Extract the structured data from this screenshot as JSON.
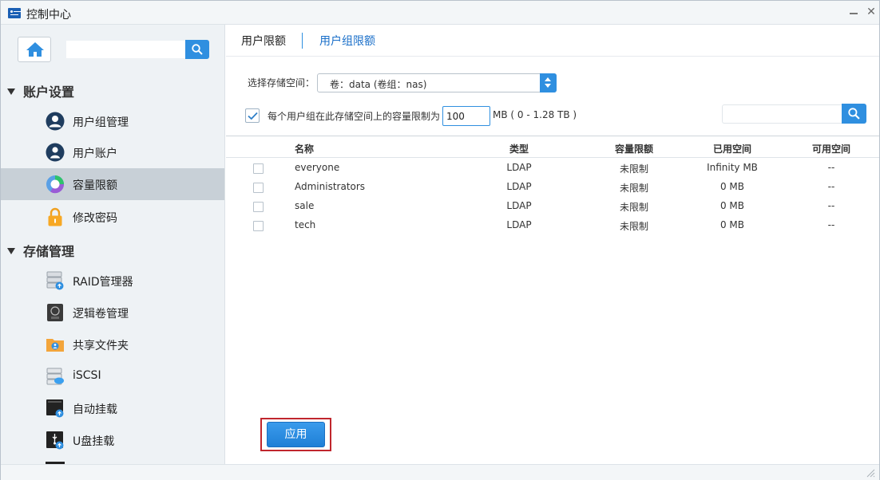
{
  "window": {
    "title": "控制中心"
  },
  "sidebar": {
    "search": {
      "placeholder": ""
    },
    "sections": [
      {
        "label": "账户设置"
      },
      {
        "label": "存储管理"
      }
    ],
    "items": [
      {
        "label": "用户组管理",
        "icon": "user-group-icon"
      },
      {
        "label": "用户账户",
        "icon": "user-icon"
      },
      {
        "label": "容量限额",
        "icon": "quota-chart-icon"
      },
      {
        "label": "修改密码",
        "icon": "lock-icon"
      },
      {
        "label": "RAID管理器",
        "icon": "raid-icon"
      },
      {
        "label": "逻辑卷管理",
        "icon": "lvm-icon"
      },
      {
        "label": "共享文件夹",
        "icon": "shared-folder-icon"
      },
      {
        "label": "iSCSI",
        "icon": "iscsi-icon"
      },
      {
        "label": "自动挂载",
        "icon": "auto-mount-icon"
      },
      {
        "label": "U盘挂载",
        "icon": "usb-mount-icon"
      }
    ],
    "active_item": "容量限额"
  },
  "tabs": [
    {
      "label": "用户限额"
    },
    {
      "label": "用户组限额"
    }
  ],
  "form": {
    "storage_label": "选择存储空间：",
    "storage_value": "卷：data (卷组：nas)",
    "limit_checked": true,
    "limit_label": "每个用户组在此存储空间上的容量限制为",
    "limit_value": "100",
    "range_label": "MB ( 0 - 1.28 TB )",
    "filter_placeholder": ""
  },
  "table": {
    "columns": [
      "名称",
      "类型",
      "容量限额",
      "已用空间",
      "可用空间"
    ],
    "rows": [
      {
        "name": "everyone",
        "type": "LDAP",
        "quota": "未限制",
        "used": "Infinity MB",
        "avail": "--"
      },
      {
        "name": "Administrators",
        "type": "LDAP",
        "quota": "未限制",
        "used": "0 MB",
        "avail": "--"
      },
      {
        "name": "sale",
        "type": "LDAP",
        "quota": "未限制",
        "used": "0 MB",
        "avail": "--"
      },
      {
        "name": "tech",
        "type": "LDAP",
        "quota": "未限制",
        "used": "0 MB",
        "avail": "--"
      }
    ]
  },
  "apply_label": "应用",
  "colors": {
    "accent": "#2f8fe0",
    "highlight_border": "#c0262d",
    "active_nav": "#c8d0d7"
  }
}
